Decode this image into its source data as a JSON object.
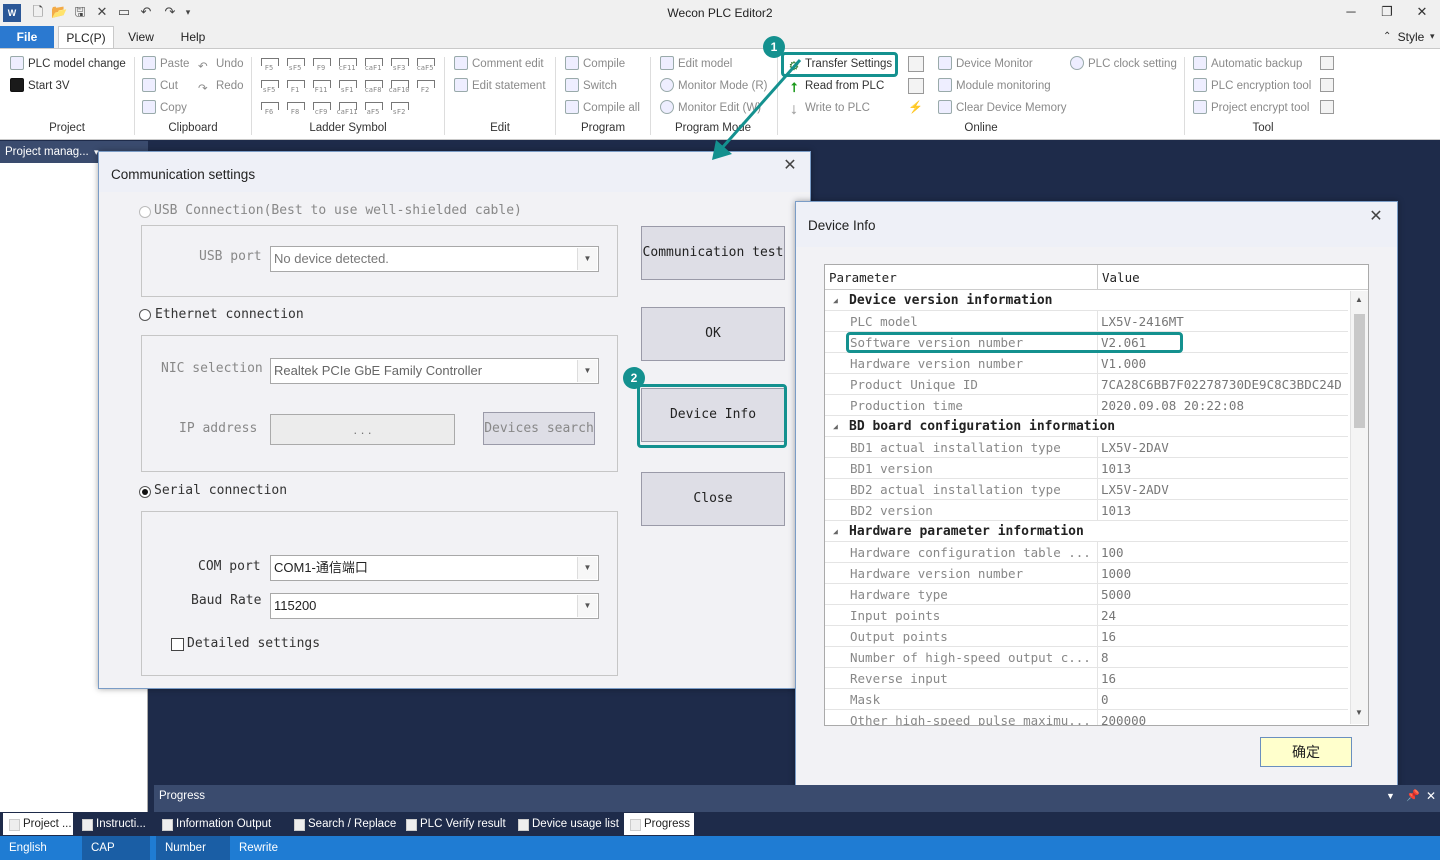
{
  "window": {
    "title": "Wecon PLC Editor2"
  },
  "menu": {
    "tabs": [
      "File",
      "PLC(P)",
      "View",
      "Help"
    ],
    "style_label": "Style"
  },
  "ribbon": {
    "project": {
      "items": [
        "PLC model change",
        "Start 3V"
      ],
      "group": "Project"
    },
    "clipboard": {
      "items": [
        "Paste",
        "Cut",
        "Copy",
        "Undo",
        "Redo"
      ],
      "group": "Clipboard"
    },
    "ladder": {
      "symbols": [
        "F5",
        "sF5",
        "F9",
        "cF11",
        "caF1",
        "sF3",
        "caF5",
        "sF5",
        "F1",
        "F11",
        "sF1",
        "caF8",
        "caF10",
        "F2",
        "F6",
        "F8",
        "cF9",
        "caF11",
        "aF5",
        "sF2"
      ],
      "group": "Ladder Symbol"
    },
    "edit": {
      "items": [
        "Comment edit",
        "Edit statement"
      ],
      "group": "Edit"
    },
    "program": {
      "items": [
        "Compile",
        "Switch",
        "Compile all"
      ],
      "group": "Program"
    },
    "program_mode": {
      "items": [
        "Edit model",
        "Monitor Mode (R)",
        "Monitor Edit (W)"
      ],
      "group": "Program Mode"
    },
    "online": {
      "items": [
        "Transfer Settings",
        "Read from PLC",
        "Write to PLC",
        "Device Monitor",
        "Module monitoring",
        "Clear Device Memory",
        "PLC clock setting"
      ],
      "group": "Online"
    },
    "tool": {
      "items": [
        "Automatic backup",
        "PLC encryption tool",
        "Project encrypt tool"
      ],
      "group": "Tool"
    }
  },
  "left_pane": {
    "title": "Project manag..."
  },
  "annotations": {
    "marker1": "1",
    "marker2": "2"
  },
  "comm": {
    "title": "Communication settings",
    "usb_label": "USB Connection(Best to use well-shielded cable)",
    "usb_port_label": "USB port",
    "usb_port_value": "No device detected.",
    "eth_label": "Ethernet connection",
    "nic_label": "NIC selection",
    "nic_value": "Realtek PCIe GbE Family Controller",
    "ip_label": "IP address",
    "ip_value": ".        .        .",
    "devices_search": "Devices search",
    "serial_label": "Serial connection",
    "com_label": "COM port",
    "com_value": "COM1-通信端口",
    "baud_label": "Baud Rate",
    "baud_value": "115200",
    "detailed": "Detailed settings",
    "btn_test": "Communication test",
    "btn_ok": "OK",
    "btn_devinfo": "Device Info",
    "btn_close": "Close"
  },
  "devinfo": {
    "title": "Device Info",
    "col_param": "Parameter",
    "col_value": "Value",
    "confirm": "确定",
    "rows": [
      {
        "p": "Device version information",
        "v": "",
        "cat": true
      },
      {
        "p": "PLC model",
        "v": "LX5V-2416MT"
      },
      {
        "p": "Software version number",
        "v": "V2.061"
      },
      {
        "p": "Hardware version number",
        "v": "V1.000"
      },
      {
        "p": "Product Unique ID",
        "v": "7CA28C6BB7F02278730DE9C8C3BDC24D"
      },
      {
        "p": "Production time",
        "v": "2020.09.08 20:22:08"
      },
      {
        "p": "BD board configuration information",
        "v": "",
        "cat": true
      },
      {
        "p": "BD1 actual installation type",
        "v": "LX5V-2DAV"
      },
      {
        "p": "BD1 version",
        "v": "1013"
      },
      {
        "p": "BD2 actual installation type",
        "v": "LX5V-2ADV"
      },
      {
        "p": "BD2 version",
        "v": "1013"
      },
      {
        "p": "Hardware parameter information",
        "v": "",
        "cat": true
      },
      {
        "p": "Hardware configuration table ...",
        "v": "100"
      },
      {
        "p": "Hardware version number",
        "v": "1000"
      },
      {
        "p": "Hardware type",
        "v": "5000"
      },
      {
        "p": "Input points",
        "v": "24"
      },
      {
        "p": "Output points",
        "v": "16"
      },
      {
        "p": "Number of high-speed output c...",
        "v": "8"
      },
      {
        "p": "Reverse input",
        "v": "16"
      },
      {
        "p": "Mask",
        "v": "0"
      },
      {
        "p": "Other high-speed pulse maximu...",
        "v": "200000"
      }
    ]
  },
  "bottom": {
    "progress_title": "Progress",
    "left_tabs": [
      "Project ...",
      "Instructi..."
    ],
    "tabs": [
      "Information Output",
      "Search / Replace",
      "PLC Verify result",
      "Device usage list",
      "Progress"
    ]
  },
  "status": {
    "items": [
      "English",
      "CAP",
      "Number",
      "Rewrite"
    ]
  }
}
